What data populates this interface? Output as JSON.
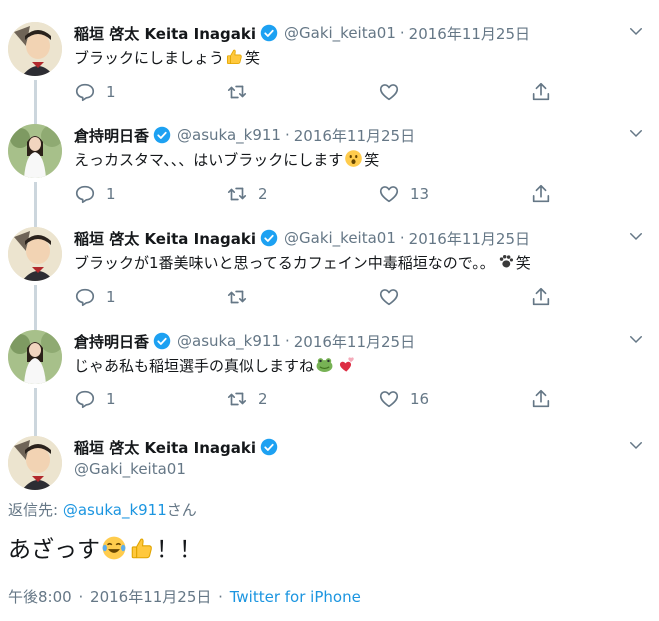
{
  "tweets": [
    {
      "name": "稲垣 啓太 Keita Inagaki",
      "handle": "@Gaki_keita01",
      "date": "2016年11月25日",
      "text_before": "ブラックにしましょう",
      "text_after": "笑",
      "replies": "1",
      "retweets": "",
      "likes": ""
    },
    {
      "name": "倉持明日香",
      "handle": "@asuka_k911",
      "date": "2016年11月25日",
      "text_before": "えっカスタマ、、、はいブラックにします",
      "text_after": "笑",
      "replies": "1",
      "retweets": "2",
      "likes": "13"
    },
    {
      "name": "稲垣 啓太 Keita Inagaki",
      "handle": "@Gaki_keita01",
      "date": "2016年11月25日",
      "text_before": "ブラックが1番美味いと思ってるカフェイン中毒稲垣なので。。",
      "text_after": "笑",
      "replies": "1",
      "retweets": "",
      "likes": ""
    },
    {
      "name": "倉持明日香",
      "handle": "@asuka_k911",
      "date": "2016年11月25日",
      "text_before": "じゃあ私も稲垣選手の真似しますね",
      "text_after": "",
      "replies": "1",
      "retweets": "2",
      "likes": "16"
    }
  ],
  "main_tweet": {
    "name": "稲垣 啓太 Keita Inagaki",
    "handle": "@Gaki_keita01",
    "reply_prefix": "返信先: ",
    "reply_mention": "@asuka_k911",
    "reply_suffix": "さん",
    "text_before": "あざっす",
    "text_after": "！！",
    "time": "午後8:00",
    "date": "2016年11月25日",
    "source": "Twitter for iPhone"
  },
  "separator": "·",
  "colors": {
    "link": "#1b95e0",
    "secondary": "#657786",
    "verified": "#1da1f2",
    "thread_line": "#ccd6dd"
  },
  "icons": [
    "verified-badge-icon",
    "chevron-down-icon",
    "reply-icon",
    "retweet-icon",
    "like-icon",
    "share-icon"
  ]
}
